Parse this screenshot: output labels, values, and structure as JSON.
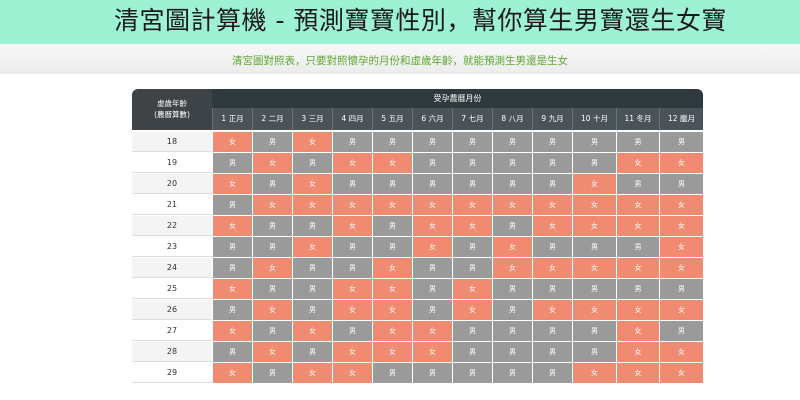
{
  "banner": {
    "title": "清宮圖計算機 - 預測寶寶性別，幫你算生男寶還生女寶"
  },
  "subtitle": "清宮圖對照表，只要對照懷孕的月份和虛歲年齡，就能預測生男還是生女",
  "table": {
    "corner_line1": "虛歲年齡",
    "corner_line2": "(農曆算數)",
    "header": "受孕農曆月份",
    "months": [
      "1 正月",
      "2 二月",
      "3 三月",
      "4 四月",
      "5 五月",
      "6 六月",
      "7 七月",
      "8 八月",
      "9 九月",
      "10 十月",
      "11 冬月",
      "12 臘月"
    ],
    "rows": [
      {
        "age": "18",
        "cells": [
          "女",
          "男",
          "女",
          "男",
          "男",
          "男",
          "男",
          "男",
          "男",
          "男",
          "男",
          "男"
        ]
      },
      {
        "age": "19",
        "cells": [
          "男",
          "女",
          "男",
          "女",
          "女",
          "男",
          "男",
          "男",
          "男",
          "男",
          "女",
          "女"
        ]
      },
      {
        "age": "20",
        "cells": [
          "女",
          "男",
          "女",
          "男",
          "男",
          "男",
          "男",
          "男",
          "男",
          "女",
          "男",
          "男"
        ]
      },
      {
        "age": "21",
        "cells": [
          "男",
          "女",
          "女",
          "女",
          "女",
          "女",
          "女",
          "女",
          "女",
          "女",
          "女",
          "女"
        ]
      },
      {
        "age": "22",
        "cells": [
          "女",
          "男",
          "男",
          "女",
          "男",
          "女",
          "女",
          "男",
          "女",
          "女",
          "女",
          "女"
        ]
      },
      {
        "age": "23",
        "cells": [
          "男",
          "男",
          "女",
          "男",
          "男",
          "女",
          "男",
          "女",
          "男",
          "男",
          "男",
          "女"
        ]
      },
      {
        "age": "24",
        "cells": [
          "男",
          "女",
          "男",
          "男",
          "女",
          "男",
          "男",
          "女",
          "女",
          "女",
          "女",
          "女"
        ]
      },
      {
        "age": "25",
        "cells": [
          "女",
          "男",
          "男",
          "女",
          "女",
          "男",
          "女",
          "男",
          "男",
          "男",
          "男",
          "男"
        ]
      },
      {
        "age": "26",
        "cells": [
          "男",
          "女",
          "男",
          "女",
          "女",
          "男",
          "女",
          "男",
          "女",
          "女",
          "女",
          "女"
        ]
      },
      {
        "age": "27",
        "cells": [
          "女",
          "男",
          "女",
          "男",
          "女",
          "女",
          "男",
          "男",
          "男",
          "男",
          "女",
          "男"
        ]
      },
      {
        "age": "28",
        "cells": [
          "男",
          "女",
          "男",
          "女",
          "女",
          "女",
          "男",
          "男",
          "男",
          "男",
          "女",
          "女"
        ]
      },
      {
        "age": "29",
        "cells": [
          "女",
          "男",
          "女",
          "女",
          "男",
          "男",
          "男",
          "男",
          "男",
          "女",
          "女",
          "女"
        ]
      }
    ]
  },
  "colors": {
    "female": "#f08a70",
    "male": "#9a9a9a",
    "banner": "#9ef2d4",
    "subtitle": "#5fa832"
  }
}
